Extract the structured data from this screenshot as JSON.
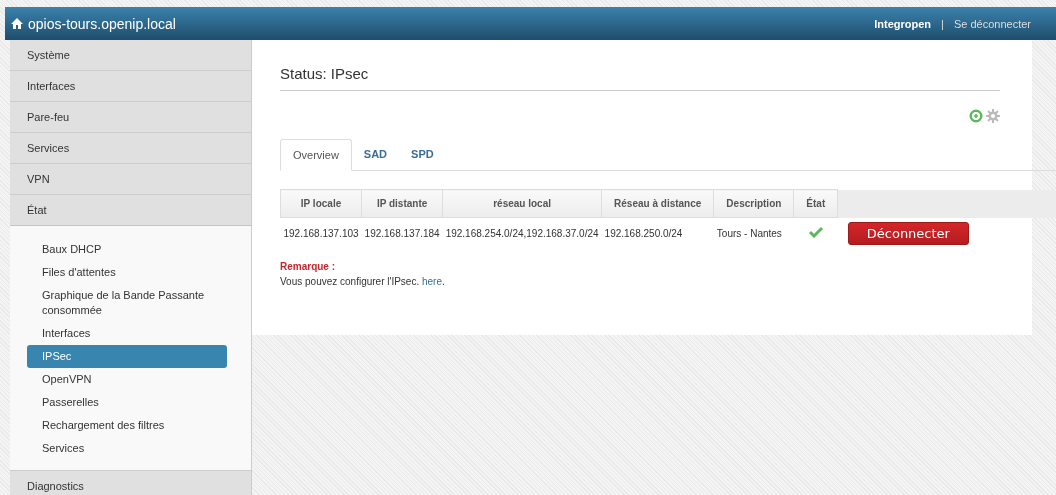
{
  "header": {
    "host": "opios-tours.openip.local",
    "user": "Integropen",
    "separator": "|",
    "logout": "Se déconnecter"
  },
  "sidebar": {
    "items": [
      {
        "label": "Système"
      },
      {
        "label": "Interfaces"
      },
      {
        "label": "Pare-feu"
      },
      {
        "label": "Services"
      },
      {
        "label": "VPN"
      },
      {
        "label": "État",
        "expanded": true,
        "children": [
          {
            "label": "Baux DHCP",
            "selected": false
          },
          {
            "label": "Files d'attentes",
            "selected": false
          },
          {
            "label": "Graphique de la Bande Passante consommée",
            "selected": false
          },
          {
            "label": "Interfaces",
            "selected": false
          },
          {
            "label": "IPSec",
            "selected": true
          },
          {
            "label": "OpenVPN",
            "selected": false
          },
          {
            "label": "Passerelles",
            "selected": false
          },
          {
            "label": "Rechargement des filtres",
            "selected": false
          },
          {
            "label": "Services",
            "selected": false
          }
        ]
      },
      {
        "label": "Diagnostics"
      }
    ]
  },
  "page_title": "Status: IPsec",
  "tabs": [
    {
      "label": "Overview",
      "selected": true
    },
    {
      "label": "SAD",
      "selected": false
    },
    {
      "label": "SPD",
      "selected": false
    }
  ],
  "table": {
    "columns": [
      "IP locale",
      "IP distante",
      "réseau local",
      "Réseau à distance",
      "Description",
      "État"
    ],
    "rows": [
      {
        "cells": [
          "192.168.137.103",
          "192.168.137.184",
          "192.168.254.0/24,192.168.37.0/24",
          "192.168.250.0/24",
          "Tours - Nantes"
        ],
        "connected": true,
        "action": "Déconnecter"
      }
    ]
  },
  "note": {
    "label": "Remarque :",
    "text": "Vous pouvez configurer l'IPsec.",
    "link": "here",
    "suffix": "."
  }
}
